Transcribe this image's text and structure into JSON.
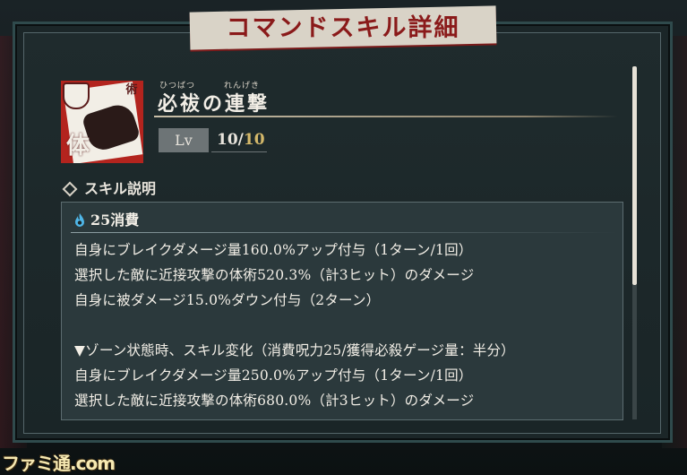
{
  "window_title": "コマンドスキル詳細",
  "skill": {
    "name": "必祓の連撃",
    "ruby_1": "ひつばつ",
    "ruby_2": "れんげき",
    "icon_kanji": "体",
    "icon_corner": "術",
    "level_label": "Lv",
    "level_current": "10",
    "level_separator": "/",
    "level_max": "10"
  },
  "description": {
    "section_title": "スキル説明",
    "cost": "25消費",
    "lines": [
      "自身にブレイクダメージ量160.0%アップ付与（1ターン/1回）",
      "選択した敵に近接攻撃の体術520.3%（計3ヒット）のダメージ",
      "自身に被ダメージ15.0%ダウン付与（2ターン）",
      "",
      "▼ゾーン状態時、スキル変化（消費呪力25/獲得必殺ゲージ量：半分）",
      "自身にブレイクダメージ量250.0%アップ付与（1ターン/1回）",
      "選択した敵に近接攻撃の体術680.0%（計3ヒット）のダメージ"
    ]
  },
  "watermark": "ファミ通.com",
  "colors": {
    "title_red": "#8a1a1a",
    "icon_red": "#b3241e",
    "level_max_gold": "#d4b86a",
    "cost_blue": "#4fb6e8"
  }
}
